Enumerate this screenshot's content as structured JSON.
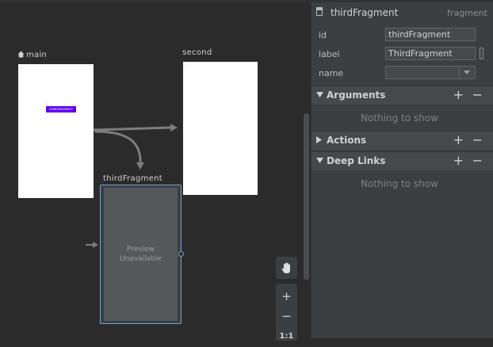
{
  "canvas": {
    "destinations": {
      "main": {
        "label": "main",
        "button_label": "THIRDFRAGMENT"
      },
      "second": {
        "label": "second"
      },
      "third": {
        "label": "thirdFragment",
        "preview_text": "Preview\nUnavailable"
      }
    },
    "controls": {
      "pan": "hand-icon",
      "zoom_in": "+",
      "zoom_out": "−",
      "zoom_actual": "1:1"
    }
  },
  "panel": {
    "title": "thirdFragment",
    "type": "fragment",
    "attributes": [
      {
        "label": "id",
        "value": "thirdFragment"
      },
      {
        "label": "label",
        "value": "ThirdFragment"
      },
      {
        "label": "name",
        "value": ""
      }
    ],
    "sections": {
      "arguments": {
        "title": "Arguments",
        "empty": "Nothing to show",
        "add": "+",
        "remove": "−"
      },
      "actions": {
        "title": "Actions",
        "add": "+",
        "remove": "−"
      },
      "deep_links": {
        "title": "Deep Links",
        "empty": "Nothing to show",
        "add": "+",
        "remove": "−"
      }
    }
  },
  "colors": {
    "accent": "#6fa3d8",
    "button": "#6200ee"
  }
}
